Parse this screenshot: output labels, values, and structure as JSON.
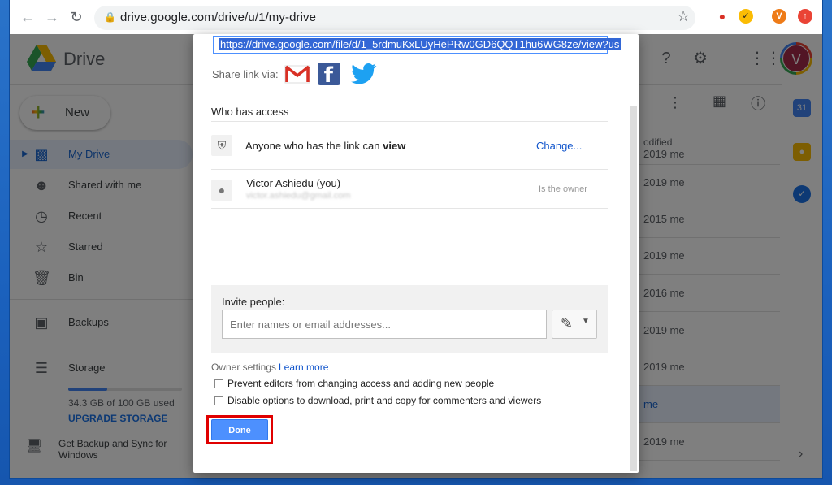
{
  "browser": {
    "url": "drive.google.com/drive/u/1/my-drive",
    "profile_letter": "V",
    "colors": {
      "profile": "#ee7b18"
    }
  },
  "drive": {
    "app_name": "Drive",
    "avatar_letter": "V",
    "new_label": "New",
    "nav": [
      {
        "label": "My Drive",
        "icon": "my-drive-icon"
      },
      {
        "label": "Shared with me",
        "icon": "people-icon"
      },
      {
        "label": "Recent",
        "icon": "clock-icon"
      },
      {
        "label": "Starred",
        "icon": "star-icon"
      },
      {
        "label": "Bin",
        "icon": "trash-icon"
      },
      {
        "label": "Backups",
        "icon": "backup-icon"
      },
      {
        "label": "Storage",
        "icon": "storage-icon"
      }
    ],
    "storage_used_text": "34.3 GB of 100 GB used",
    "storage_fraction": 0.343,
    "upgrade_label": "UPGRADE STORAGE",
    "backup_promo": "Get Backup and Sync for Windows",
    "column_header": "odified",
    "rows": [
      "2019 me",
      "2019 me",
      "2015 me",
      "2019 me",
      "2016 me",
      "2019 me",
      "2019 me",
      "me",
      "2019 me"
    ]
  },
  "dialog": {
    "link": "https://drive.google.com/file/d/1_5rdmuKxLUyHePRw0GD6QQT1hu6WG8ze/view?us",
    "share_via": "Share link via:",
    "who_has_access": "Who has access",
    "access_prefix": "Anyone who has the link can",
    "access_level": "view",
    "change_label": "Change...",
    "owner_name": "Victor Ashiedu (you)",
    "owner_email": "victor.ashiedu@gmail.com",
    "owner_role": "Is the owner",
    "invite_label": "Invite people:",
    "invite_placeholder": "Enter names or email addresses...",
    "owner_settings": "Owner settings",
    "learn_more": "Learn more",
    "option1": "Prevent editors from changing access and adding new people",
    "option2": "Disable options to download, print and copy for commenters and viewers",
    "done_label": "Done",
    "colors": {
      "primary": "#4d90fe",
      "link": "#1155cc",
      "highlight": "#e00000"
    }
  }
}
